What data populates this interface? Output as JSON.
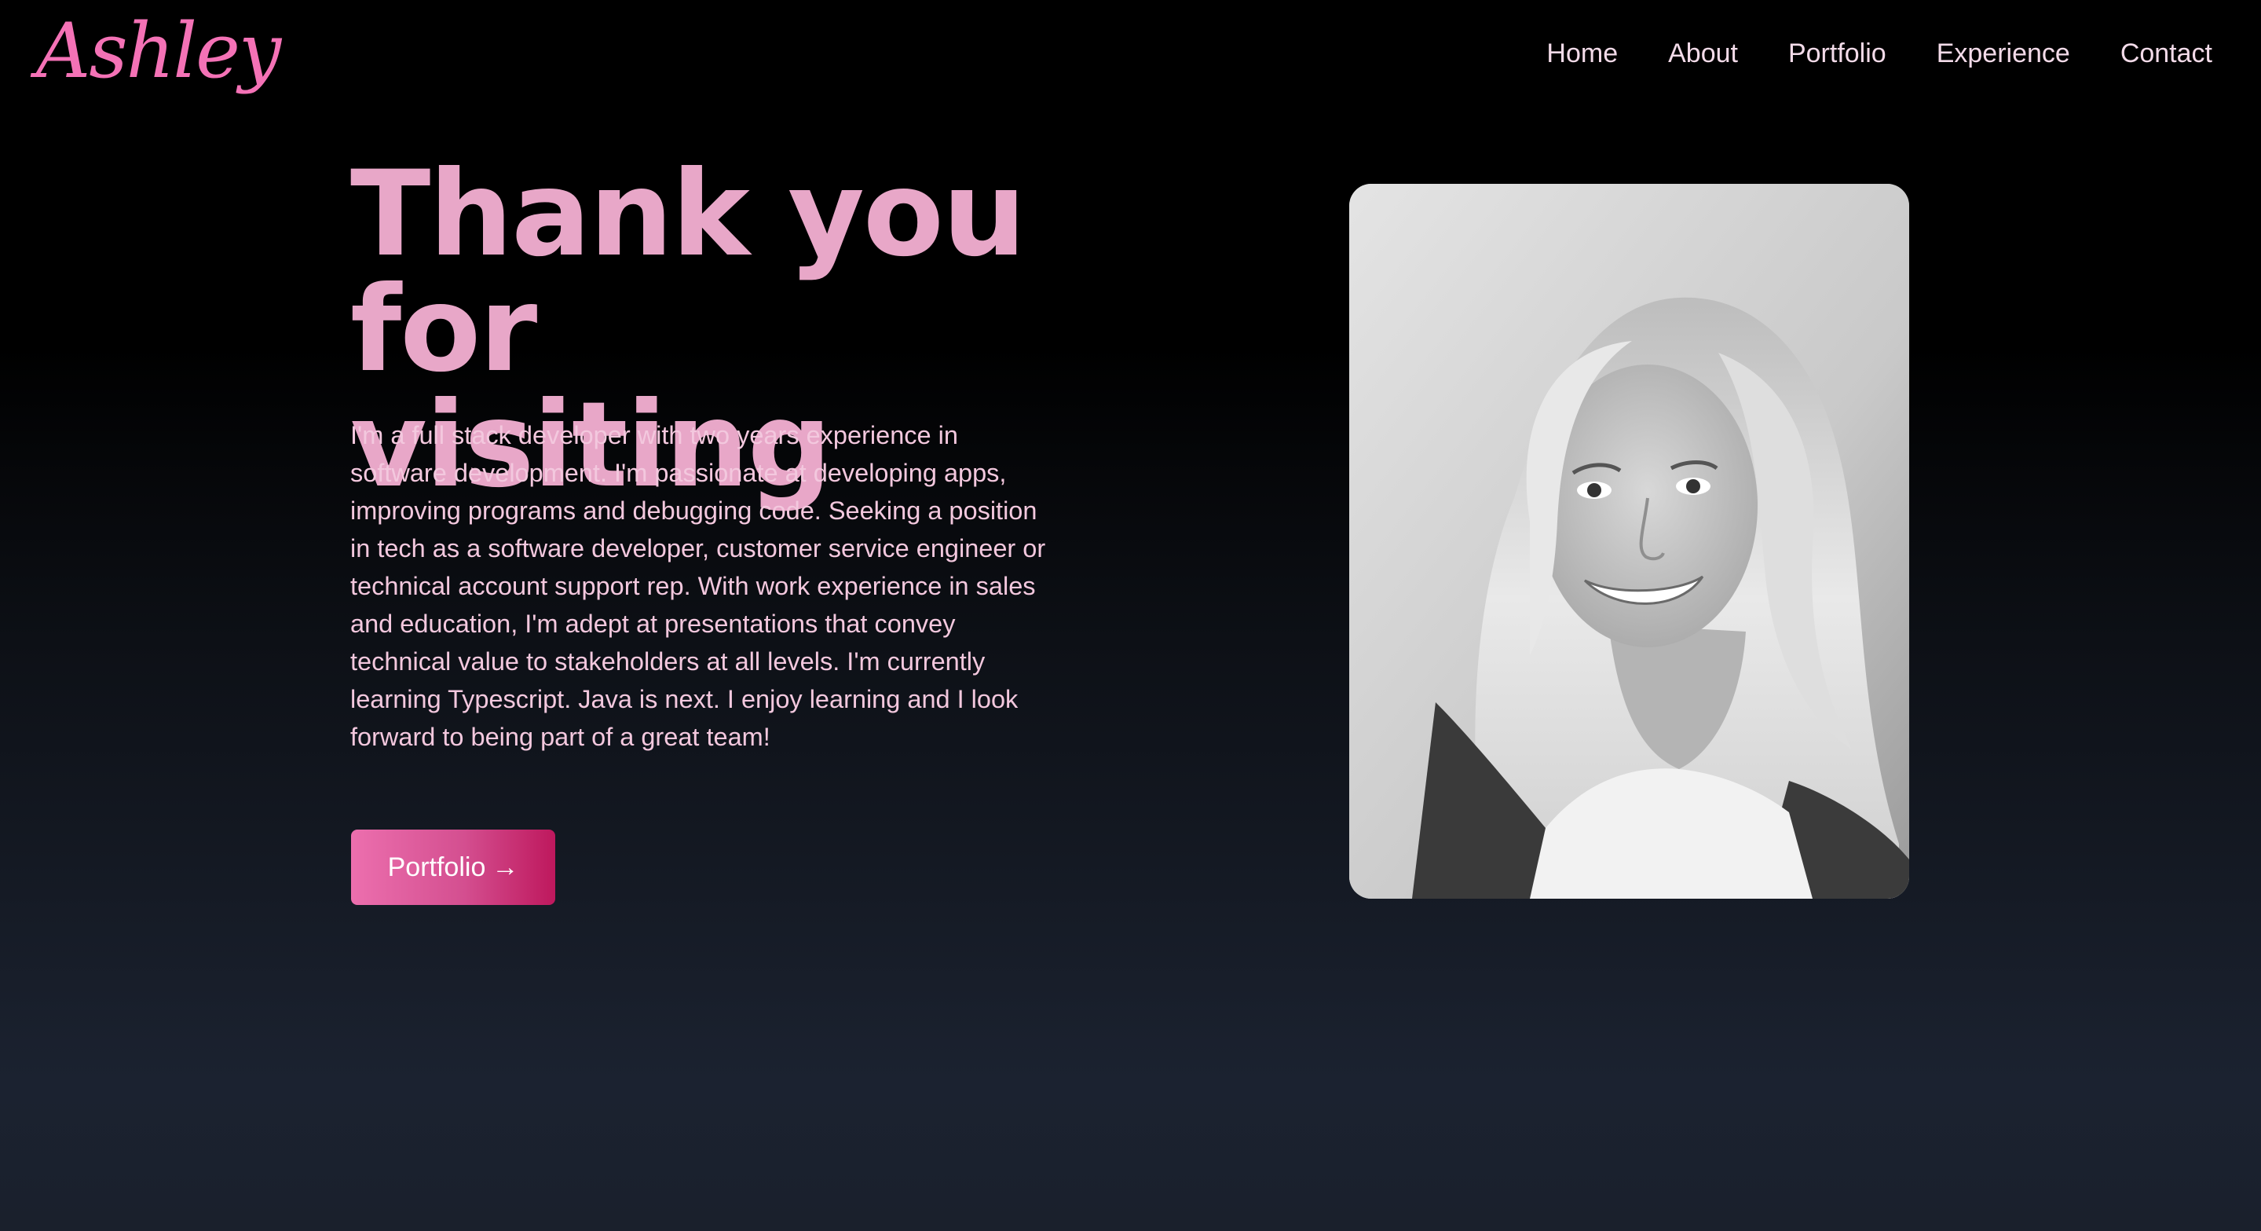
{
  "brand": {
    "logo_text": "Ashley",
    "accent_color": "#f472b6"
  },
  "nav": {
    "items": [
      {
        "label": "Home"
      },
      {
        "label": "About"
      },
      {
        "label": "Portfolio"
      },
      {
        "label": "Experience"
      },
      {
        "label": "Contact"
      }
    ]
  },
  "hero": {
    "title_line1": "Thank you for",
    "title_line2": "visiting",
    "bio": "I'm a full stack developer with two years experience in software development. I'm passionate at developing apps, improving programs and debugging code. Seeking a position in tech as a software developer, customer service engineer or technical account support rep. With work experience in sales and education, I'm adept at presentations that convey technical value to stakeholders at all levels. I'm currently learning Typescript. Java is next. I enjoy learning and I look forward to being part of a great team!",
    "cta_label": "Portfolio",
    "cta_icon": "→"
  },
  "colors": {
    "headline": "#e8a7c8",
    "body_text": "#f3c8de",
    "nav_text": "#f3dbe9",
    "button_gradient_start": "#ec6fae",
    "button_gradient_end": "#be185d"
  }
}
